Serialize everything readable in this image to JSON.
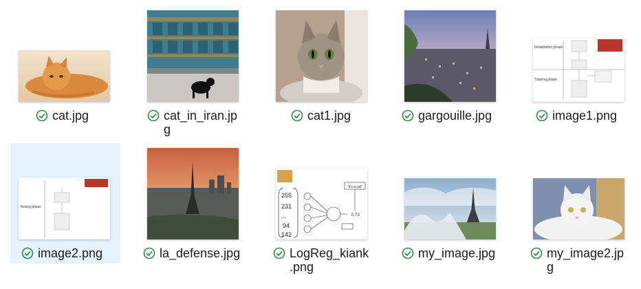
{
  "files": [
    {
      "name": "cat.jpg",
      "status_icon": "synced-check-icon"
    },
    {
      "name": "cat_in_iran.jpg",
      "line1": "cat_in_iran.jp",
      "line2": "g",
      "status_icon": "synced-check-icon"
    },
    {
      "name": "cat1.jpg",
      "status_icon": "synced-check-icon"
    },
    {
      "name": "gargouille.jpg",
      "status_icon": "synced-check-icon"
    },
    {
      "name": "image1.png",
      "status_icon": "synced-check-icon",
      "thumb_text": {
        "phase1": "Initialization phase",
        "phase2": "Training phase"
      }
    },
    {
      "name": "image2.png",
      "status_icon": "synced-check-icon",
      "selected": true,
      "thumb_text": {
        "phase": "Testing phase"
      }
    },
    {
      "name": "la_defense.jpg",
      "status_icon": "synced-check-icon"
    },
    {
      "name": "LogReg_kiank.png",
      "line1": "LogReg_kiank",
      "line2": ".png",
      "status_icon": "synced-check-icon",
      "thumb_text": {
        "n1": "255",
        "n2": "231",
        "n3": "...",
        "n4": "94",
        "n5": "142",
        "result": "0.73",
        "caption": "\"it's a cat\""
      }
    },
    {
      "name": "my_image.jpg",
      "status_icon": "synced-check-icon"
    },
    {
      "name": "my_image2.jpg",
      "line1": "my_image2.jp",
      "line2": "g",
      "status_icon": "synced-check-icon"
    }
  ],
  "colors": {
    "selection": "#e5f3ff",
    "check": "#2f8a44",
    "text": "#1b1b1b"
  }
}
